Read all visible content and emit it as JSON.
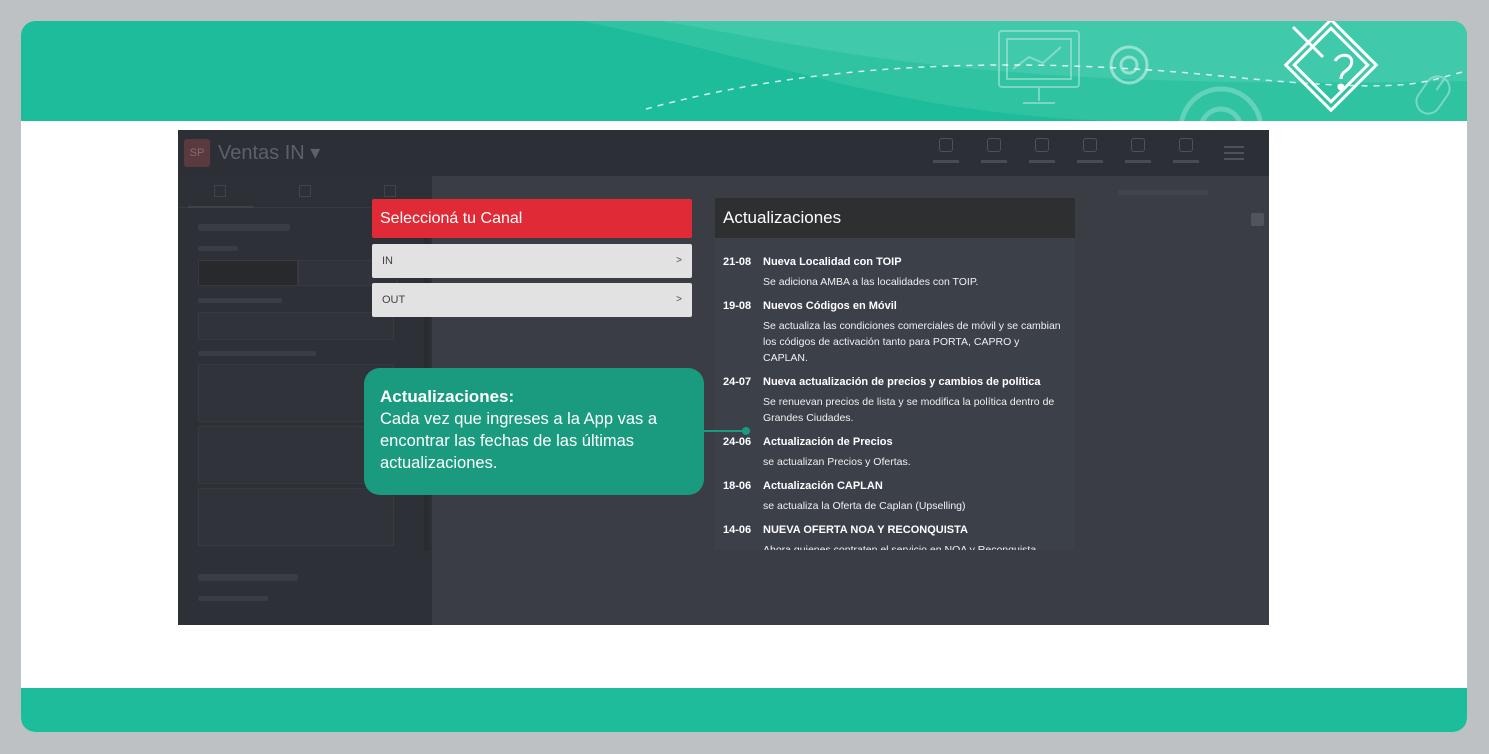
{
  "app": {
    "logo_text": "SP",
    "title": "Ventas IN ▾"
  },
  "canal": {
    "header": "Seleccioná tu Canal",
    "options": [
      {
        "label": "IN",
        "chevron": ">"
      },
      {
        "label": "OUT",
        "chevron": ">"
      }
    ]
  },
  "updates": {
    "header": "Actualizaciones",
    "entries": [
      {
        "date": "21-08",
        "title": "Nueva Localidad con TOIP",
        "desc": "Se adiciona AMBA a las localidades con TOIP."
      },
      {
        "date": "19-08",
        "title": "Nuevos Códigos en Móvil",
        "desc": "Se actualiza las condiciones comerciales de móvil y se cambian los códigos de activación tanto para PORTA, CAPRO y CAPLAN."
      },
      {
        "date": "24-07",
        "title": "Nueva actualización de precios y cambios de política",
        "desc": "Se renuevan precios de lista y se modifica la política dentro de Grandes Ciudades."
      },
      {
        "date": "24-06",
        "title": "Actualización de Precios",
        "desc": "se actualizan Precios y Ofertas."
      },
      {
        "date": "18-06",
        "title": "Actualización CAPLAN",
        "desc": "se actualiza la Oferta de Caplan (Upselling)"
      },
      {
        "date": "14-06",
        "title": "NUEVA OFERTA NOA Y RECONQUISTA",
        "desc": "Ahora quienes contraten el servicio en NOA y Reconquista"
      }
    ]
  },
  "callout": {
    "title": "Actualizaciones:",
    "text": "Cada vez que ingreses a la App vas a encontrar las fechas de las últimas actualizaciones."
  },
  "colors": {
    "band": "#1dbd9b",
    "callout": "#1a9b80",
    "canal_header": "#e02a36"
  }
}
